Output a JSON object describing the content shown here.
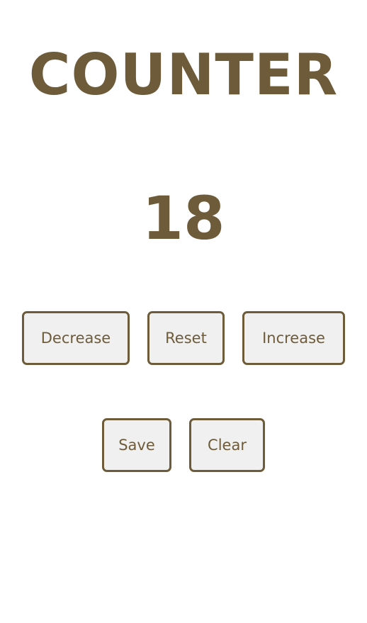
{
  "title": "COUNTER",
  "count": "18",
  "buttons": {
    "decrease": "Decrease",
    "reset": "Reset",
    "increase": "Increase",
    "save": "Save",
    "clear": "Clear"
  },
  "colors": {
    "text": "#6e5b39",
    "button_bg": "#f0f0f0",
    "background": "#ffffff"
  }
}
